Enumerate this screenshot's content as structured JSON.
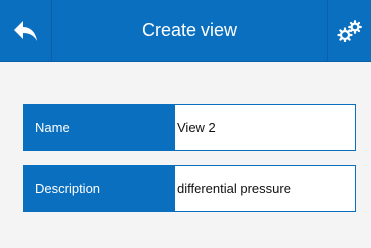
{
  "header": {
    "title": "Create view",
    "back_icon": "back-arrow-icon",
    "settings_icon": "gears-icon"
  },
  "form": {
    "name": {
      "label": "Name",
      "value": "View 2"
    },
    "description": {
      "label": "Description",
      "value": "differential pressure"
    }
  },
  "colors": {
    "accent": "#0b6fc0",
    "background": "#f4f4f4",
    "field_background": "#ffffff"
  }
}
